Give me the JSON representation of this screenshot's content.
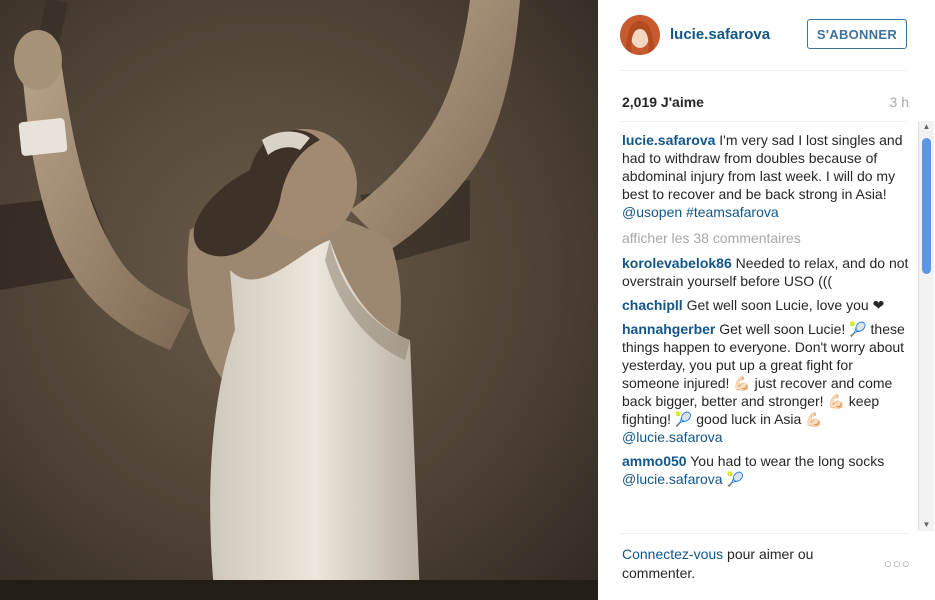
{
  "post": {
    "username": "lucie.safarova",
    "follow_label": "S'ABONNER",
    "likes": "2,019 J'aime",
    "time": "3 h",
    "caption": {
      "text": "I'm very sad I lost singles and had to withdraw from doubles because of abdominal injury from last week. I will do my best to recover and be back strong in Asia!",
      "mention": "@usopen",
      "hashtag": "#teamsafarova"
    },
    "more_comments": "afficher les 38 commentaires",
    "comments": [
      {
        "user": "korolevabelok86",
        "text": "Needed to relax, and do not overstrain yourself before USO ((("
      },
      {
        "user": "chachipll",
        "text": "Get well soon Lucie, love you ❤"
      },
      {
        "user": "hannahgerber",
        "text": "Get well soon Lucie! 🎾 these things happen to everyone. Don't worry about yesterday, you put up a great fight for someone injured! 💪🏻 just recover and come back bigger, better and stronger! 💪🏻 keep fighting! 🎾 good luck in Asia 💪🏻",
        "mention": "@lucie.safarova"
      },
      {
        "user": "ammo050",
        "text": "You had to wear the long socks",
        "mention": "@lucie.safarova",
        "suffix": " 🎾"
      }
    ]
  },
  "footer": {
    "login_link": "Connectez-vous",
    "login_rest": " pour aimer ou commenter.",
    "more": "○○○"
  },
  "scrollbar": {
    "up": "▲",
    "down": "▼"
  },
  "icons": {
    "avatar": "avatar-icon",
    "more": "more-options-icon"
  },
  "colors": {
    "link": "#125688",
    "follow": "#3f729b",
    "muted": "#a5a7aa",
    "scroll_thumb": "#5b97e6"
  }
}
